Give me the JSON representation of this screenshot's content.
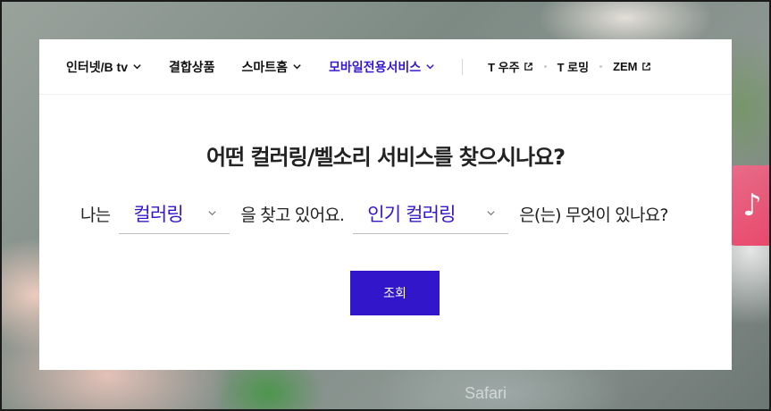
{
  "nav": {
    "items": [
      {
        "label": "인터넷/B tv",
        "icon": "chevron-down-icon",
        "active": false
      },
      {
        "label": "결합상품",
        "icon": null,
        "active": false
      },
      {
        "label": "스마트홈",
        "icon": "chevron-down-icon",
        "active": false
      },
      {
        "label": "모바일전용서비스",
        "icon": "chevron-down-icon",
        "active": true
      }
    ],
    "external": [
      {
        "label": "T 우주",
        "icon": "external-link-icon"
      },
      {
        "label": "T 로밍",
        "icon": null
      },
      {
        "label": "ZEM",
        "icon": "external-link-icon"
      }
    ]
  },
  "main": {
    "headline": "어떤 컬러링/벨소리 서비스를 찾으시나요?",
    "prefix": "나는",
    "select1_value": "컬러링",
    "middle": "을 찾고 있어요.",
    "select2_value": "인기 컬러링",
    "suffix": "은(는) 무엇이 있나요?",
    "search_button": "조회"
  },
  "background": {
    "app_label": "Safari"
  },
  "colors": {
    "accent": "#3617cd",
    "button": "#3117c9",
    "text": "#222222"
  }
}
